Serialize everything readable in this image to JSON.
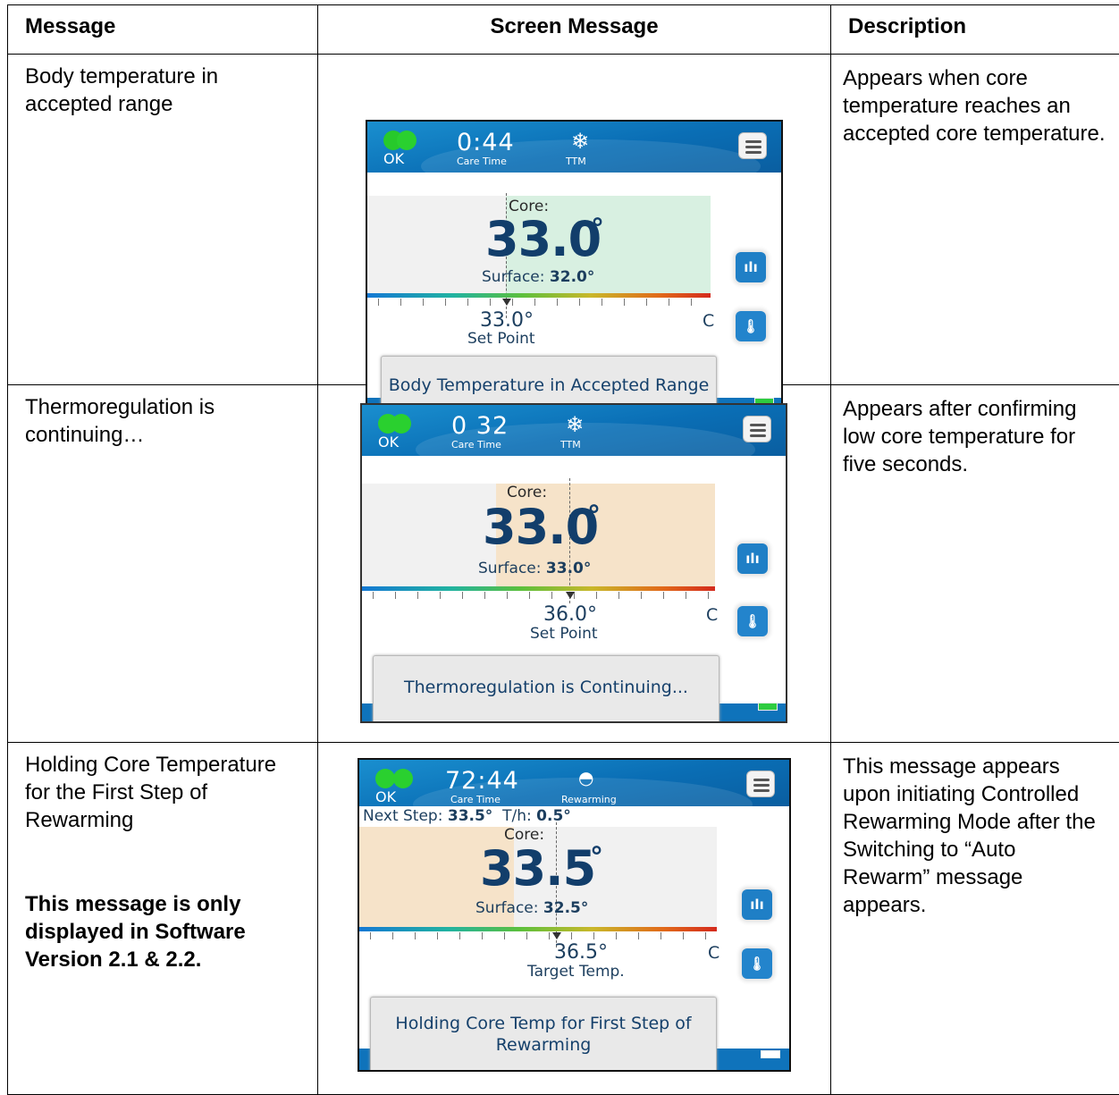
{
  "table": {
    "headers": [
      "Message",
      "Screen Message",
      "Description"
    ],
    "rows": [
      {
        "message": "Body temperature in accepted range",
        "description": "Appears when core temperature reaches an accepted core temperature.",
        "screen": {
          "status": "OK",
          "time": "0:44",
          "time_label": "Care Time",
          "mode": "TTM",
          "mode_icon": "snowflake-icon",
          "core_label": "Core:",
          "core_value": "33.0",
          "surface_label": "Surface:",
          "surface_value": "32.0°",
          "setpoint_value": "33.0°",
          "setpoint_label": "Set Point",
          "unit": "C",
          "banner": "Body Temperature in Accepted Range",
          "battery": "green"
        }
      },
      {
        "message": "Thermoregulation is continuing…",
        "description": "Appears after confirming low core temperature for five seconds.",
        "screen": {
          "status": "OK",
          "time": "0 32",
          "time_label": "Care Time",
          "mode": "TTM",
          "mode_icon": "snowflake-icon",
          "core_label": "Core:",
          "core_value": "33.0",
          "surface_label": "Surface:",
          "surface_value": "33.0°",
          "setpoint_value": "36.0°",
          "setpoint_label": "Set Point",
          "unit": "C",
          "banner": "Thermoregulation is Continuing...",
          "battery": "green"
        }
      },
      {
        "message": "Holding Core Temperature for the First Step of Rewarming",
        "note": "This message is only displayed in Software Version 2.1 & 2.2.",
        "description": "This message appears upon initiating Controlled Rewarming Mode after the Switching to “Auto Rewarm” message appears.",
        "screen": {
          "status": "OK",
          "time": "72:44",
          "time_label": "Care Time",
          "mode": "Rewarming",
          "mode_icon": "gauge-icon",
          "next_step_label": "Next Step:",
          "next_step_value": "33.5°",
          "th_label": "T/h:",
          "th_value": "0.5°",
          "core_label": "Core:",
          "core_value": "33.5",
          "surface_label": "Surface:",
          "surface_value": "32.5°",
          "setpoint_value": "36.5°",
          "setpoint_label": "Target Temp.",
          "unit": "C",
          "banner": "Holding Core Temp for First Step of Rewarming",
          "battery": "white"
        }
      }
    ]
  },
  "colors": {
    "header_blue": "#0a6eb5",
    "status_green": "#27c92b",
    "accepted_fill": "#d8f0e1",
    "warm_fill": "#f6e3c9",
    "value_navy": "#123e6b"
  }
}
